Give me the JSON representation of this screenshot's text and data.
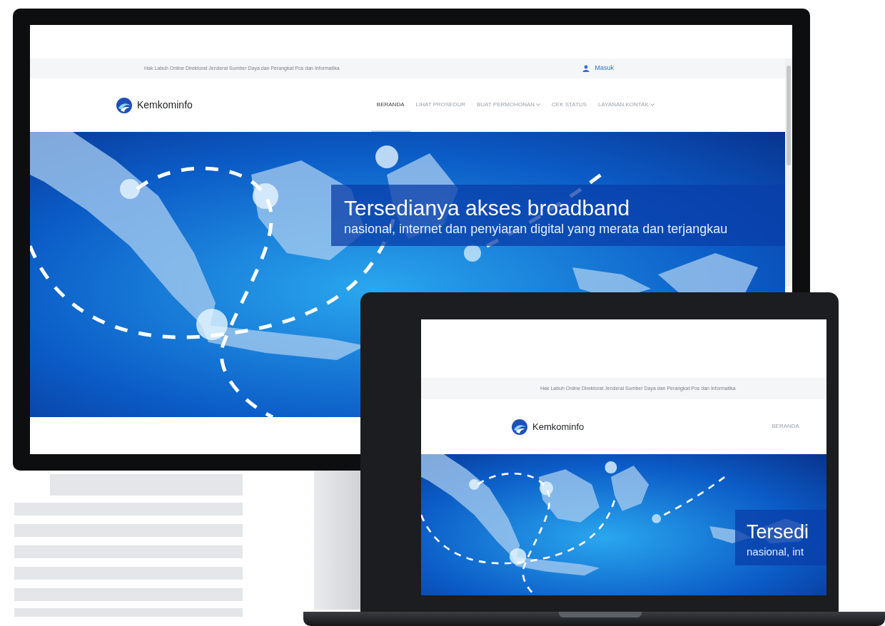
{
  "monitor": {
    "top_bar": {
      "text": "Hak Labuh Online Direktorat Jenderal Sumber Daya dan Perangkat Pos dan Informatika",
      "login": "Masuk"
    },
    "logo": "Kemkominfo",
    "nav": [
      {
        "label": "BERANDA",
        "selected": true,
        "dropdown": false
      },
      {
        "label": "LIHAT PROSEDUR",
        "selected": false,
        "dropdown": false
      },
      {
        "label": "BUAT PERMOHONAN",
        "selected": false,
        "dropdown": true
      },
      {
        "label": "CEK STATUS",
        "selected": false,
        "dropdown": false
      },
      {
        "label": "LAYANAN KONTAK",
        "selected": false,
        "dropdown": true
      }
    ],
    "banner": {
      "headline": "Tersedianya akses broadband",
      "subline": "nasional, internet dan penyiaran digital yang merata dan terjangkau"
    }
  },
  "laptop": {
    "top_bar": {
      "text": "Hak Labuh Online Direktorat Jenderal Sumber Daya dan Perangkat Pos dan Informatika"
    },
    "logo": "Kemkominfo",
    "nav": [
      {
        "label": "BERANDA",
        "selected": false,
        "dropdown": false
      }
    ],
    "banner": {
      "headline": "Tersedi",
      "subline": "nasional, int"
    }
  }
}
